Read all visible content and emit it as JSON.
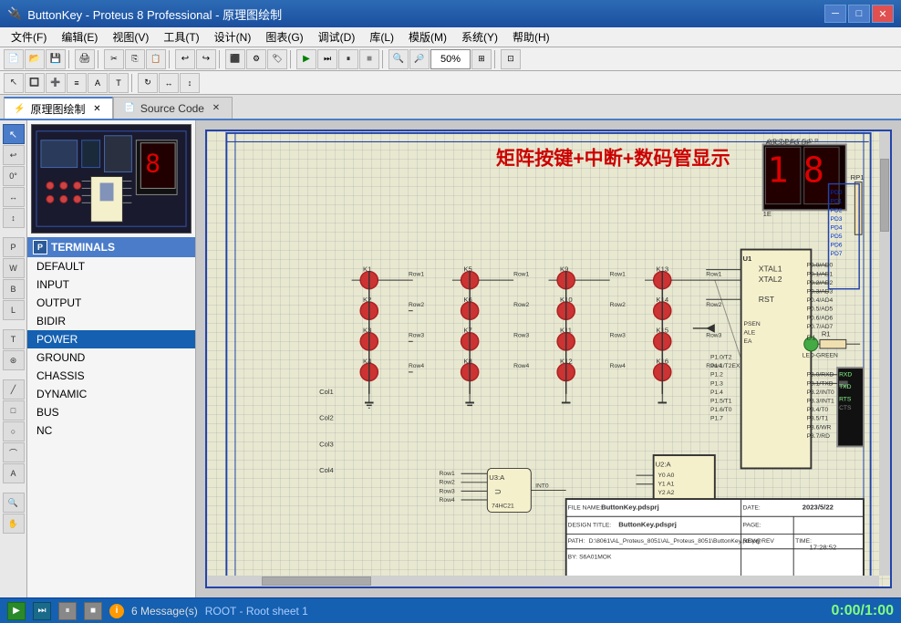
{
  "app": {
    "title": "ButtonKey - Proteus 8 Professional - 原理图绘制",
    "icon": "🔌"
  },
  "titlebar": {
    "minimize": "─",
    "maximize": "□",
    "close": "✕"
  },
  "menu": {
    "items": [
      "文件(F)",
      "编辑(E)",
      "视图(V)",
      "工具(T)",
      "设计(N)",
      "图表(G)",
      "调试(D)",
      "库(L)",
      "模版(M)",
      "系统(Y)",
      "帮助(H)"
    ]
  },
  "tabs": [
    {
      "id": "schematic",
      "label": "原理图绘制",
      "icon": "⚡",
      "active": true
    },
    {
      "id": "source",
      "label": "Source Code",
      "icon": "📄",
      "active": false
    }
  ],
  "left_panel": {
    "header": "TERMINALS",
    "header_icon": "P",
    "items": [
      {
        "label": "DEFAULT",
        "selected": false
      },
      {
        "label": "INPUT",
        "selected": false
      },
      {
        "label": "OUTPUT",
        "selected": false
      },
      {
        "label": "BIDIR",
        "selected": false
      },
      {
        "label": "POWER",
        "selected": true
      },
      {
        "label": "GROUND",
        "selected": false
      },
      {
        "label": "CHASSIS",
        "selected": false
      },
      {
        "label": "DYNAMIC",
        "selected": false
      },
      {
        "label": "BUS",
        "selected": false
      },
      {
        "label": "NC",
        "selected": false
      }
    ]
  },
  "schematic": {
    "title": "矩阵按键+中断+数码管显示",
    "title_block": {
      "file_name_label": "FILE NAME:",
      "file_name": "ButtonKey.pdsprj",
      "design_title_label": "DESIGN TITLE:",
      "design_title": "ButtonKey.pdsprj",
      "path_label": "PATH:",
      "path": "D:\\8061\\AL_Proteus_8051\\AL_Proteus_8051\\ButtonKey.pdsprj",
      "by_label": "BY:",
      "by": "S6A01MOK",
      "date_label": "DATE:",
      "date": "2023/5/22",
      "page_label": "PAGE:",
      "page": "",
      "rev_label": "REV@REV",
      "time_label": "TIME:",
      "time": "17:28:52"
    }
  },
  "status": {
    "play": "▶",
    "step_fwd": "⏭",
    "pause": "⏸",
    "stop": "■",
    "messages": "6 Message(s)",
    "sheet": "ROOT - Root sheet 1",
    "time": "0:00/1:00",
    "info_icon": "i"
  },
  "toolbar": {
    "zoom_level": "50%"
  }
}
